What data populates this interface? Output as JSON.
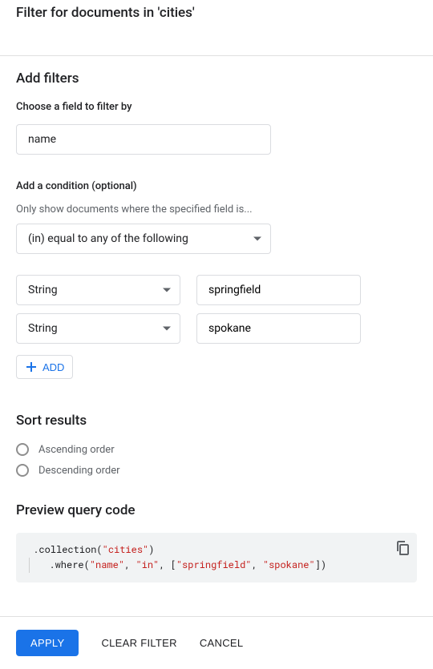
{
  "title": "Filter for documents in 'cities'",
  "addFilters": {
    "heading": "Add filters",
    "fieldLabel": "Choose a field to filter by",
    "fieldValue": "name",
    "conditionLabel": "Add a condition (optional)",
    "conditionHelp": "Only show documents where the specified field is...",
    "conditionSelected": "(in) equal to any of the following",
    "rows": [
      {
        "type": "String",
        "value": "springfield"
      },
      {
        "type": "String",
        "value": "spokane"
      }
    ],
    "addLabel": "ADD"
  },
  "sort": {
    "heading": "Sort results",
    "ascending": "Ascending order",
    "descending": "Descending order"
  },
  "preview": {
    "heading": "Preview query code",
    "code": {
      "collection": "cities",
      "field": "name",
      "op": "in",
      "values": [
        "springfield",
        "spokane"
      ]
    }
  },
  "footer": {
    "apply": "APPLY",
    "clear": "CLEAR FILTER",
    "cancel": "CANCEL"
  }
}
